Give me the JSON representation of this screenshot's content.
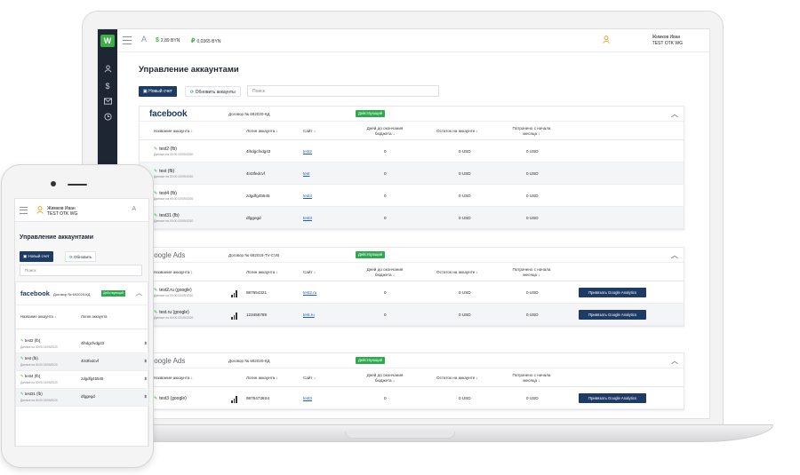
{
  "desktop": {
    "balances": [
      "2,89 BYN",
      "0,0365 BYN"
    ],
    "lang": "A",
    "user": {
      "name": "Жимков Иван",
      "company": "TEST OTK WG"
    },
    "page_title": "Управление аккаунтами",
    "new_account": "Новый счет",
    "update_accounts": "Обновить аккаунты",
    "search_placeholder": "Поиск",
    "columns": [
      "Название аккаунта",
      "Логин аккаунта",
      "Сайт",
      "Дней до окончания бюджета",
      "Остаток на аккаунте",
      "Потрачено с начала месяца"
    ],
    "cards": [
      {
        "brand": "facebook",
        "contract": "Договор № 692020-КД",
        "status": "Действующий",
        "rows": [
          {
            "name": "test2 (fb)",
            "sub": "Данные на 00:00 02/09/2020",
            "login": "4lhdgcfvdg43",
            "site": "test2",
            "days": "0",
            "rest": "0 USD",
            "spent": "0 USD"
          },
          {
            "name": "test (fb)",
            "sub": "Данные на 00:00 02/09/2020",
            "login": "4l43fedcvf",
            "site": "test",
            "days": "0",
            "rest": "0 USD",
            "spent": "0 USD"
          },
          {
            "name": "test4 (fb)",
            "sub": "Данные на 00:00 02/09/2020",
            "login": "zdgdfg45545",
            "site": "test4",
            "days": "0",
            "rest": "0 USD",
            "spent": "0 USD"
          },
          {
            "name": "test31 (fb)",
            "sub": "Данные на 00:00 02/09/2020",
            "login": "dfggegd",
            "site": "test3",
            "days": "0",
            "rest": "0 USD",
            "spent": "0 USD"
          }
        ]
      },
      {
        "brand": "Google Ads",
        "contract": "Договор № 692018-TV-CVB",
        "status": "Действующий",
        "ga_button": "Привязать Google Analytics",
        "rows": [
          {
            "name": "test2.ru (google)",
            "sub": "Данные на 00:00 02/09/2020",
            "login": "987654321",
            "site": "test2.ru",
            "days": "0",
            "rest": "0 USD",
            "spent": "0 USD"
          },
          {
            "name": "test.ru (google)",
            "sub": "Данные на 00:00 02/09/2020",
            "login": "123456789",
            "site": "test.ru",
            "days": "0",
            "rest": "0 USD",
            "spent": "0 USD"
          }
        ]
      },
      {
        "brand": "Google Ads",
        "contract": "Договор № 692020-КД",
        "status": "Действующий",
        "ga_button": "Привязать Google Analytics",
        "rows": [
          {
            "name": "test3 (google)",
            "sub": "",
            "login": "98764736S4",
            "site": "test3",
            "days": "0",
            "rest": "0 USD",
            "spent": "0 USD"
          }
        ]
      }
    ]
  },
  "mobile": {
    "user": {
      "name": "Жимков Иван",
      "company": "TEST OTK WG"
    },
    "lang": "A",
    "page_title": "Управление аккаунтами",
    "new_account": "Новый счет",
    "update": "Обновить",
    "search_placeholder": "Поиск",
    "brand": "facebook",
    "contract": "Договор № 692020-КД",
    "status": "Действующий",
    "columns": [
      "Название аккаунта",
      "Логин аккаунта"
    ],
    "rows": [
      {
        "name": "test2 (fb)",
        "sub": "Данные на 00:00 02/09/2020",
        "login": "4lhdgcfvdg43"
      },
      {
        "name": "test (fb)",
        "sub": "Данные на 00:00 02/09/2020",
        "login": "4l43fedcvf"
      },
      {
        "name": "test4 (fb)",
        "sub": "Данные на 00:00 02/09/2020",
        "login": "zdgdfg45545"
      },
      {
        "name": "test31 (fb)",
        "sub": "Данные на 00:00 02/09/2020",
        "login": "dfggegd"
      }
    ]
  }
}
